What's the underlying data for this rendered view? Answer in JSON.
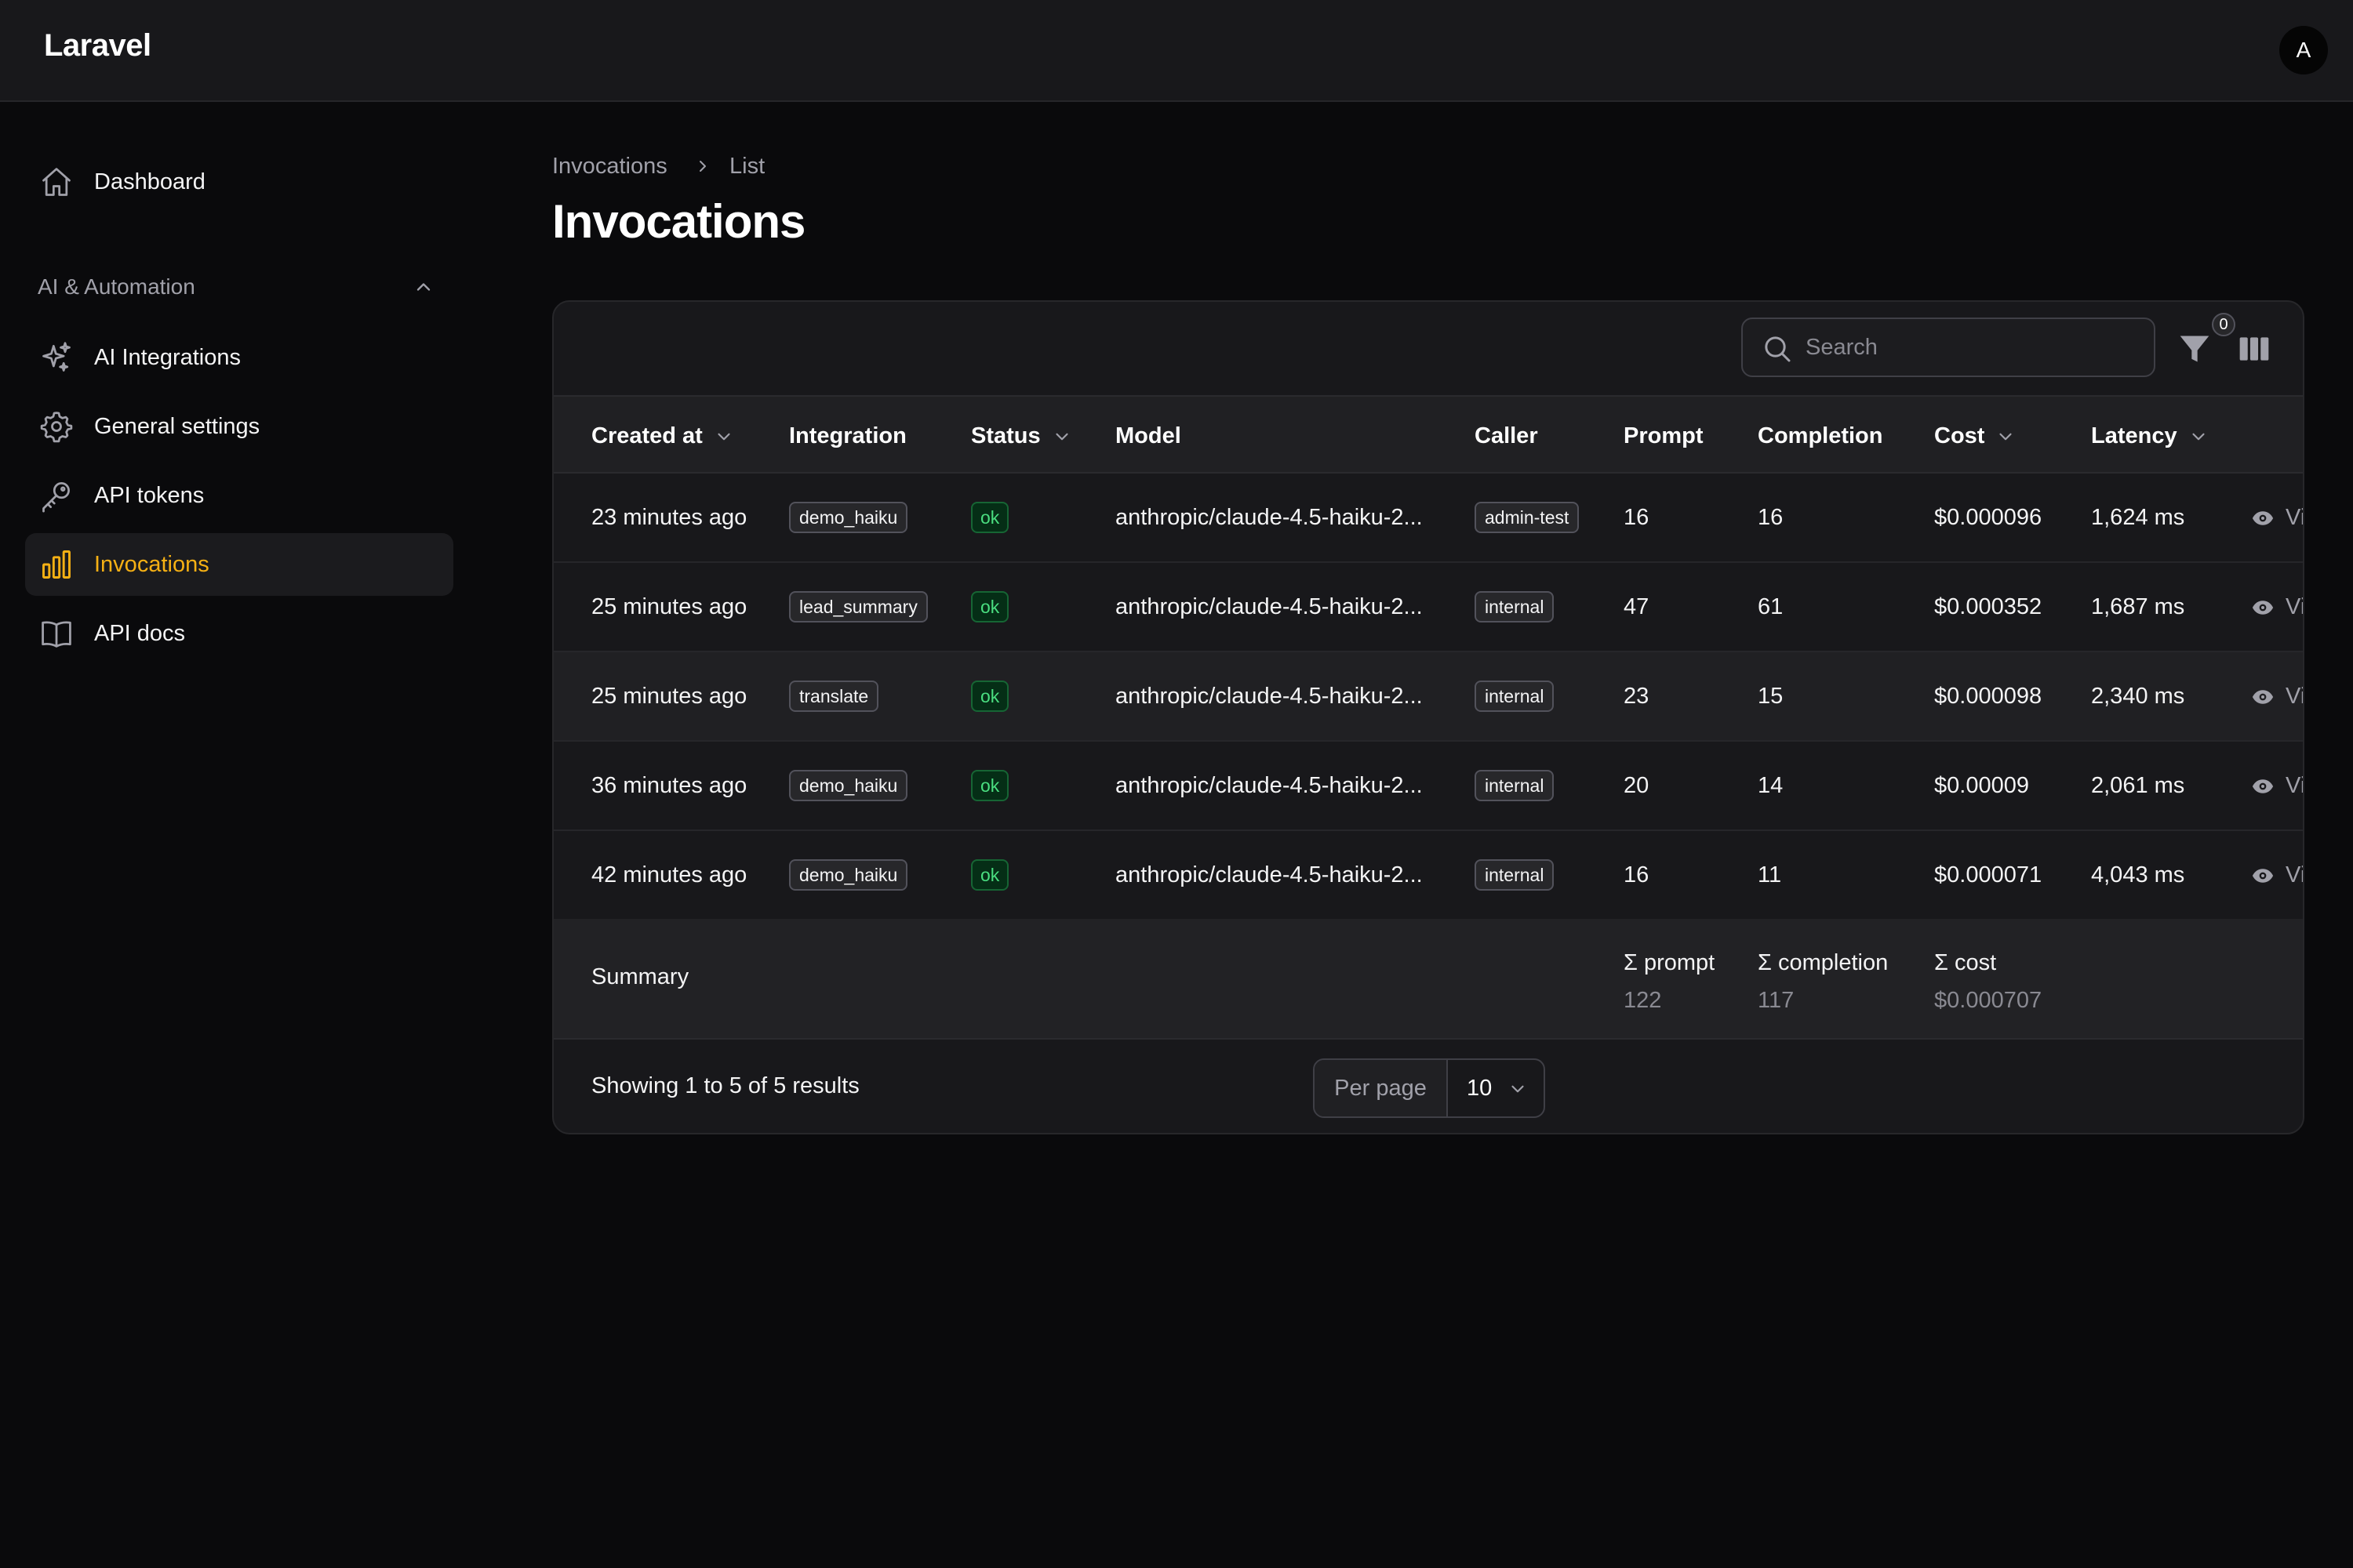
{
  "app": {
    "brand": "Laravel",
    "avatar_initial": "A"
  },
  "sidebar": {
    "dashboard": {
      "label": "Dashboard",
      "icon": "home-icon"
    },
    "group": {
      "label": "AI & Automation",
      "icon": "chevron-up-icon"
    },
    "items": [
      {
        "label": "AI Integrations",
        "icon": "sparkles-icon",
        "active": false
      },
      {
        "label": "General settings",
        "icon": "gear-icon",
        "active": false
      },
      {
        "label": "API tokens",
        "icon": "key-icon",
        "active": false
      },
      {
        "label": "Invocations",
        "icon": "bar-chart-icon",
        "active": true
      },
      {
        "label": "API docs",
        "icon": "book-icon",
        "active": false
      }
    ]
  },
  "header": {
    "breadcrumb": [
      "Invocations",
      "List"
    ],
    "title": "Invocations"
  },
  "toolbar": {
    "search_placeholder": "Search",
    "filter_count": "0"
  },
  "table": {
    "columns": [
      "Created at",
      "Integration",
      "Status",
      "Model",
      "Caller",
      "Prompt",
      "Completion",
      "Cost",
      "Latency"
    ],
    "rows": [
      {
        "created": "23 minutes ago",
        "integration": "demo_haiku",
        "status": "ok",
        "model": "anthropic/claude-4.5-haiku-2...",
        "caller": "admin-test",
        "prompt": "16",
        "completion": "16",
        "cost": "$0.000096",
        "latency": "1,624 ms",
        "action": "Vi"
      },
      {
        "created": "25 minutes ago",
        "integration": "lead_summary",
        "status": "ok",
        "model": "anthropic/claude-4.5-haiku-2...",
        "caller": "internal",
        "prompt": "47",
        "completion": "61",
        "cost": "$0.000352",
        "latency": "1,687 ms",
        "action": "Vi"
      },
      {
        "created": "25 minutes ago",
        "integration": "translate",
        "status": "ok",
        "model": "anthropic/claude-4.5-haiku-2...",
        "caller": "internal",
        "prompt": "23",
        "completion": "15",
        "cost": "$0.000098",
        "latency": "2,340 ms",
        "action": "Vi"
      },
      {
        "created": "36 minutes ago",
        "integration": "demo_haiku",
        "status": "ok",
        "model": "anthropic/claude-4.5-haiku-2...",
        "caller": "internal",
        "prompt": "20",
        "completion": "14",
        "cost": "$0.00009",
        "latency": "2,061 ms",
        "action": "Vi"
      },
      {
        "created": "42 minutes ago",
        "integration": "demo_haiku",
        "status": "ok",
        "model": "anthropic/claude-4.5-haiku-2...",
        "caller": "internal",
        "prompt": "16",
        "completion": "11",
        "cost": "$0.000071",
        "latency": "4,043 ms",
        "action": "Vi"
      }
    ],
    "summary": {
      "label": "Summary",
      "prompt_label": "Σ prompt",
      "prompt_value": "122",
      "completion_label": "Σ completion",
      "completion_value": "117",
      "cost_label": "Σ cost",
      "cost_value": "$0.000707"
    }
  },
  "pagination": {
    "results_text": "Showing 1 to 5 of 5 results",
    "per_page_label": "Per page",
    "per_page_value": "10"
  },
  "colors": {
    "accent": "#f5b014",
    "status_ok": "#4ade80",
    "background": "#0a0a0c",
    "surface": "#18181b"
  }
}
